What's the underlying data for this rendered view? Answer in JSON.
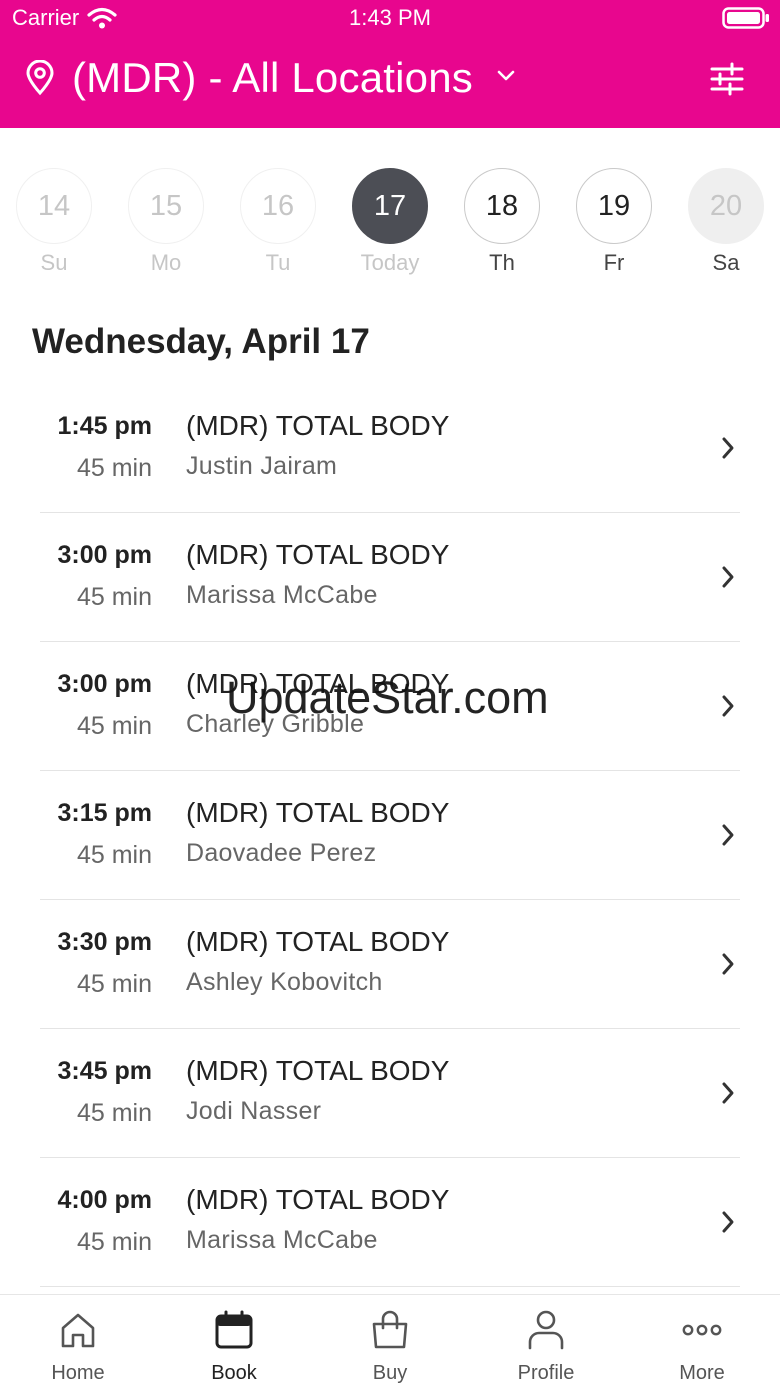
{
  "status_bar": {
    "carrier": "Carrier",
    "time": "1:43 PM"
  },
  "header": {
    "location_title": "(MDR) - All Locations",
    "brand_color": "#e8068e"
  },
  "week": [
    {
      "number": "14",
      "label": "Su",
      "state": "past"
    },
    {
      "number": "15",
      "label": "Mo",
      "state": "past"
    },
    {
      "number": "16",
      "label": "Tu",
      "state": "past"
    },
    {
      "number": "17",
      "label": "Today",
      "state": "selected"
    },
    {
      "number": "18",
      "label": "Th",
      "state": "available"
    },
    {
      "number": "19",
      "label": "Fr",
      "state": "available"
    },
    {
      "number": "20",
      "label": "Sa",
      "state": "disabled"
    }
  ],
  "date_heading": "Wednesday, April 17",
  "classes": [
    {
      "time": "1:45 pm",
      "duration": "45 min",
      "name": "(MDR) TOTAL BODY",
      "instructor": "Justin Jairam"
    },
    {
      "time": "3:00 pm",
      "duration": "45 min",
      "name": "(MDR) TOTAL BODY",
      "instructor": "Marissa McCabe"
    },
    {
      "time": "3:00 pm",
      "duration": "45 min",
      "name": "(MDR) TOTAL BODY",
      "instructor": "Charley Gribble"
    },
    {
      "time": "3:15 pm",
      "duration": "45 min",
      "name": "(MDR) TOTAL BODY",
      "instructor": "Daovadee Perez"
    },
    {
      "time": "3:30 pm",
      "duration": "45 min",
      "name": "(MDR) TOTAL BODY",
      "instructor": "Ashley Kobovitch"
    },
    {
      "time": "3:45 pm",
      "duration": "45 min",
      "name": "(MDR) TOTAL BODY",
      "instructor": "Jodi Nasser"
    },
    {
      "time": "4:00 pm",
      "duration": "45 min",
      "name": "(MDR) TOTAL BODY",
      "instructor": "Marissa McCabe"
    }
  ],
  "watermark": "UpdateStar.com",
  "tabs": [
    {
      "label": "Home",
      "icon": "home-icon",
      "active": false
    },
    {
      "label": "Book",
      "icon": "calendar-icon",
      "active": true
    },
    {
      "label": "Buy",
      "icon": "shopping-bag-icon",
      "active": false
    },
    {
      "label": "Profile",
      "icon": "person-icon",
      "active": false
    },
    {
      "label": "More",
      "icon": "more-dots-icon",
      "active": false
    }
  ]
}
